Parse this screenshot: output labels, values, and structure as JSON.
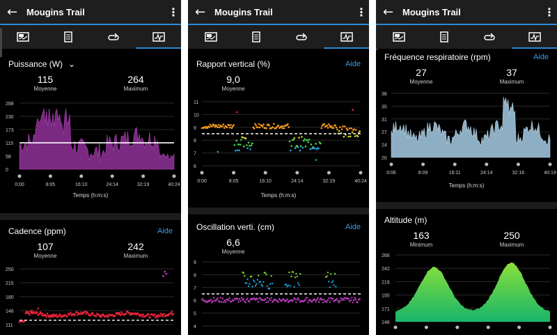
{
  "panels": [
    {
      "app_title": "Mougins Trail",
      "cards": [
        {
          "title": "Puissance (W)",
          "has_dropdown": true,
          "aide": "",
          "stats": [
            {
              "value": "115",
              "label": "Moyenne"
            },
            {
              "value": "264",
              "label": "Maximum"
            }
          ],
          "chart_data": {
            "type": "area",
            "y_ticks": [
              "288",
              "230",
              "173",
              "115",
              "58",
              "0"
            ],
            "x_ticks": [
              "0:00",
              "8:05",
              "16:10",
              "24:14",
              "32:19",
              "40:24"
            ],
            "xlabel": "Temps (h:m:s)",
            "ylim": [
              0,
              288
            ],
            "reference_line": 115,
            "fill_color": "#7a2a80"
          }
        },
        {
          "title": "Cadence (ppm)",
          "aide": "Aide",
          "stats": [
            {
              "value": "107",
              "label": "Moyenne"
            },
            {
              "value": "242",
              "label": "Maximum"
            }
          ],
          "chart_data": {
            "type": "scatter",
            "y_ticks": [
              "250",
              "215",
              "180",
              "146",
              "111"
            ],
            "ylim": [
              95,
              250
            ],
            "reference_line": 107
          }
        }
      ]
    },
    {
      "app_title": "Mougins Trail",
      "cards": [
        {
          "title": "Rapport vertical (%)",
          "aide": "Aide",
          "stats": [
            {
              "value": "9,0",
              "label": "Moyenne"
            }
          ],
          "chart_data": {
            "type": "scatter",
            "y_ticks": [
              "11",
              "10",
              "9",
              "8",
              "7",
              "6"
            ],
            "x_ticks": [
              "0:00",
              "8:05",
              "16:10",
              "24:14",
              "32:19",
              "40:24"
            ],
            "xlabel": "Temps (h:m:s)",
            "ylim": [
              6,
              11.5
            ],
            "reference_line": 8.75
          }
        },
        {
          "title": "Oscillation verti. (cm)",
          "aide": "Aide",
          "stats": [
            {
              "value": "6,6",
              "label": "Moyenne"
            }
          ],
          "chart_data": {
            "type": "scatter",
            "y_ticks": [
              "9",
              "8",
              "7",
              "6",
              "5",
              "4"
            ],
            "ylim": [
              4,
              9.2
            ],
            "reference_line": 6.6
          }
        }
      ]
    },
    {
      "app_title": "Mougins Trail",
      "cards": [
        {
          "title": "Fréquence respiratoire (rpm)",
          "aide": "Aide",
          "stats": [
            {
              "value": "27",
              "label": "Moyenne"
            },
            {
              "value": "37",
              "label": "Maximum"
            }
          ],
          "chart_data": {
            "type": "area",
            "y_ticks": [
              "38",
              "35",
              "31",
              "27",
              "24",
              "20"
            ],
            "x_ticks": [
              "0:06",
              "8:09",
              "16:11",
              "24:14",
              "32:16",
              "40:19"
            ],
            "xlabel": "Temps (h:m:s)",
            "ylim": [
              20,
              38
            ],
            "fill_color": "#8eaec3"
          }
        },
        {
          "title": "Altitude (m)",
          "aide": "",
          "stats": [
            {
              "value": "163",
              "label": "Minimum"
            },
            {
              "value": "250",
              "label": "Maximum"
            }
          ],
          "chart_data": {
            "type": "area",
            "y_ticks": [
              "266",
              "242",
              "219",
              "195",
              "171",
              "148"
            ],
            "ylim": [
              148,
              266
            ],
            "fill_color": "#5bd44a"
          }
        }
      ]
    }
  ],
  "icons": [
    "back-arrow-icon",
    "more-vert-icon",
    "summary-icon",
    "details-icon",
    "laps-icon",
    "charts-icon",
    "chevron-down-icon"
  ]
}
